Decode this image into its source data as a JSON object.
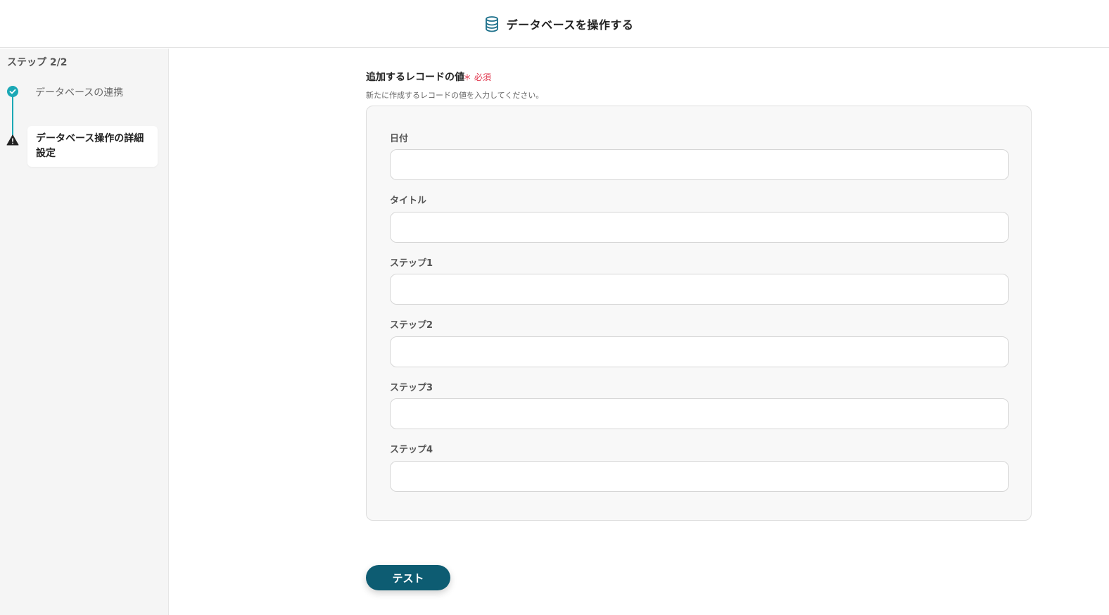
{
  "header": {
    "title": "データベースを操作する",
    "icon": "database-icon"
  },
  "sidebar": {
    "step_count": "ステップ 2/2",
    "steps": [
      {
        "label": "データベースの連携",
        "status": "completed",
        "icon": "check-circle-icon"
      },
      {
        "label": "データベース操作の詳細設定",
        "status": "warning",
        "icon": "warning-icon"
      }
    ]
  },
  "section": {
    "title": "追加するレコードの値",
    "required": "＊ 必須",
    "description": "新たに作成するレコードの値を入力してください。"
  },
  "fields": [
    {
      "label": "日付",
      "value": ""
    },
    {
      "label": "タイトル",
      "value": ""
    },
    {
      "label": "ステップ1",
      "value": ""
    },
    {
      "label": "ステップ2",
      "value": ""
    },
    {
      "label": "ステップ3",
      "value": ""
    },
    {
      "label": "ステップ4",
      "value": ""
    }
  ],
  "actions": {
    "test_label": "テスト"
  },
  "colors": {
    "accent": "#1ba8b5",
    "button": "#0d5c72",
    "required": "#e0344b"
  }
}
